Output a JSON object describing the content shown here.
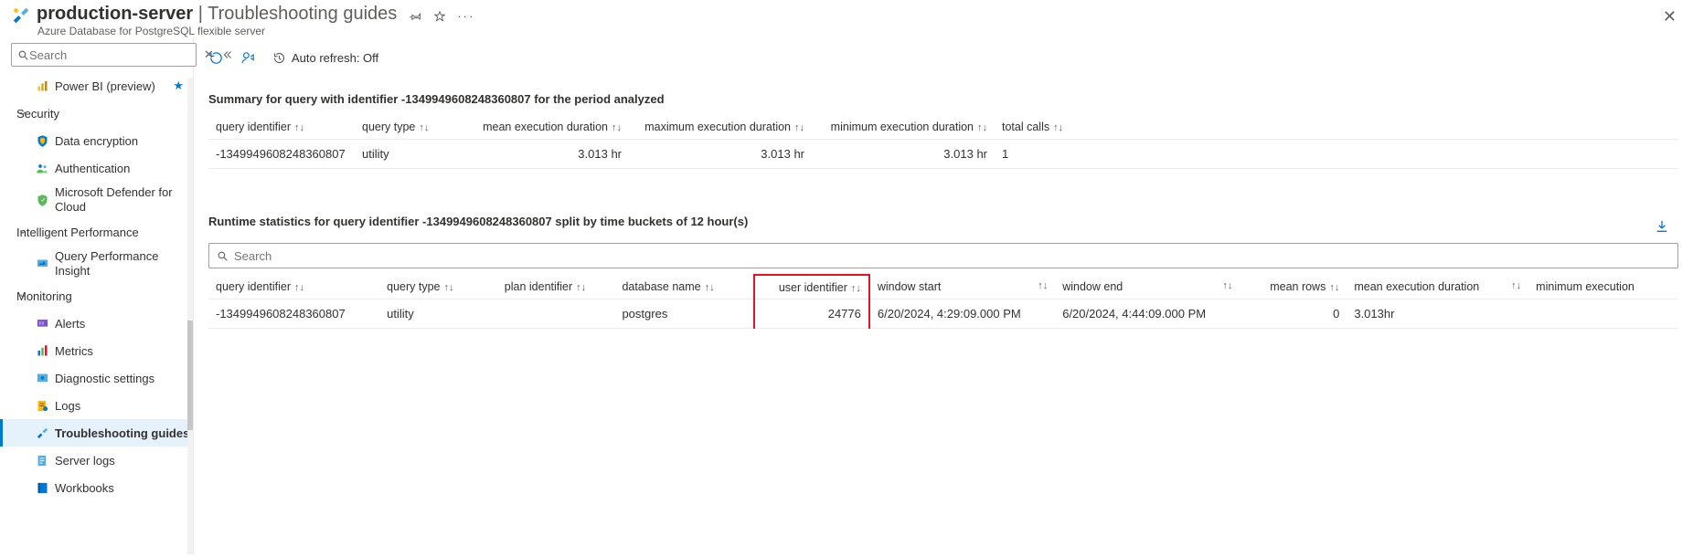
{
  "header": {
    "resource_name": "production-server",
    "page_title": "Troubleshooting guides",
    "subtitle": "Azure Database for PostgreSQL flexible server"
  },
  "sidebar": {
    "search_placeholder": "Search",
    "items": {
      "powerbi": "Power BI (preview)",
      "security_group": "Security",
      "data_encryption": "Data encryption",
      "authentication": "Authentication",
      "defender": "Microsoft Defender for Cloud",
      "intel_group": "Intelligent Performance",
      "qpi": "Query Performance Insight",
      "monitoring_group": "Monitoring",
      "alerts": "Alerts",
      "metrics": "Metrics",
      "diag": "Diagnostic settings",
      "logs": "Logs",
      "tsg": "Troubleshooting guides",
      "serverlogs": "Server logs",
      "workbooks": "Workbooks"
    }
  },
  "toolbar": {
    "autorefresh_label": "Auto refresh: Off"
  },
  "summary": {
    "title": "Summary for query with identifier -1349949608248360807 for the period analyzed",
    "columns": {
      "qid": "query identifier",
      "qtype": "query type",
      "mean": "mean execution duration",
      "max": "maximum execution duration",
      "min": "minimum execution duration",
      "calls": "total calls"
    },
    "row": {
      "qid": "-1349949608248360807",
      "qtype": "utility",
      "mean": "3.013 hr",
      "max": "3.013 hr",
      "min": "3.013 hr",
      "calls": "1"
    }
  },
  "runtime": {
    "title": "Runtime statistics for query identifier -1349949608248360807 split by time buckets of 12 hour(s)",
    "search_placeholder": "Search",
    "columns": {
      "qid": "query identifier",
      "qtype": "query type",
      "plan": "plan identifier",
      "db": "database name",
      "user": "user identifier",
      "wstart": "window start",
      "wend": "window end",
      "mrows": "mean rows",
      "mdur": "mean execution duration",
      "mindur": "minimum execution"
    },
    "row": {
      "qid": "-1349949608248360807",
      "qtype": "utility",
      "plan": "",
      "db": "postgres",
      "user": "24776",
      "wstart": "6/20/2024, 4:29:09.000 PM",
      "wend": "6/20/2024, 4:44:09.000 PM",
      "mrows": "0",
      "mdur": "3.013hr",
      "mindur": ""
    }
  }
}
